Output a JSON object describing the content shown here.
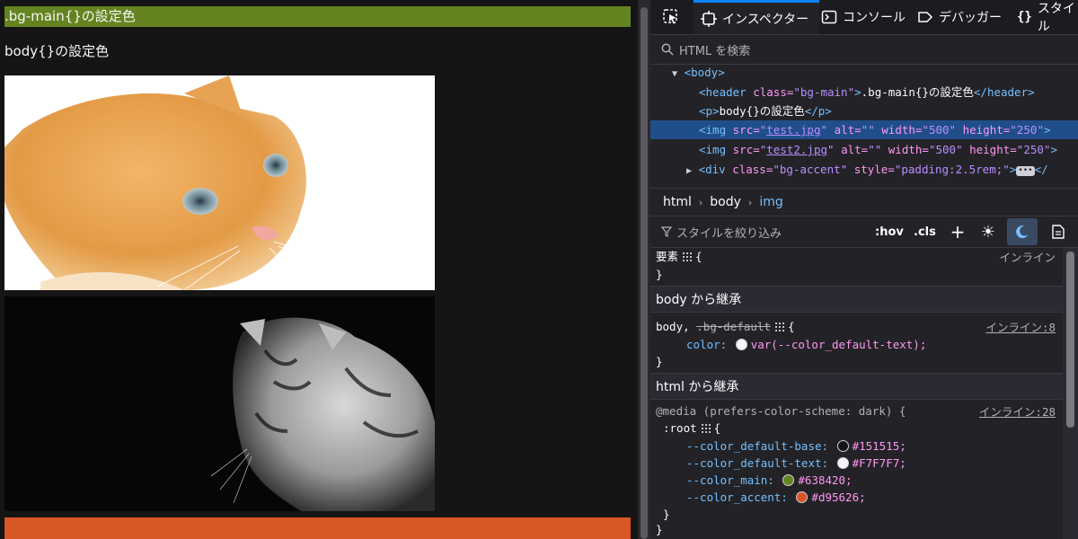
{
  "page": {
    "header_text": ".bg-main{}の設定色",
    "paragraph_text": "body{}の設定色"
  },
  "colors": {
    "base": "#151515",
    "text": "#F7F7F7",
    "main": "#638420",
    "accent": "#d95626",
    "devtools_selection": "#204e8a"
  },
  "devtools": {
    "tabs": {
      "inspector": "インスペクター",
      "console": "コンソール",
      "debugger": "デバッガー",
      "style": "スタイル"
    },
    "search_placeholder": "HTML を検索",
    "tree": {
      "body_open": "<body>",
      "header": {
        "open": "<header",
        "attr": "class=",
        "val": "\"bg-main\"",
        "close": ">",
        "text": ".bg-main{}の設定色",
        "end": "</header>"
      },
      "p": {
        "open": "<p>",
        "text": "body{}の設定色",
        "end": "</p>"
      },
      "img1": {
        "open": "<img",
        "src_attr": "src=",
        "src": "test.jpg",
        "alt_attr": "alt=",
        "alt": "\"\"",
        "w_attr": "width=",
        "w": "\"500\"",
        "h_attr": "height=",
        "h": "\"250\"",
        "close": ">"
      },
      "img2": {
        "open": "<img",
        "src_attr": "src=",
        "src": "test2.jpg",
        "alt_attr": "alt=",
        "alt": "\"\"",
        "w_attr": "width=",
        "w": "\"500\"",
        "h_attr": "height=",
        "h": "\"250\"",
        "close": ">"
      },
      "div": {
        "open": "<div",
        "class_attr": "class=",
        "class_val": "\"bg-accent\"",
        "style_attr": "style=",
        "style_val": "\"padding:2.5rem;\"",
        "close": ">",
        "end": "</"
      }
    },
    "breadcrumbs": [
      "html",
      "body",
      "img"
    ],
    "styles": {
      "filter_placeholder": "スタイルを絞り込み",
      "hov": ":hov",
      "cls": ".cls",
      "element_selector": "要素",
      "inline": "インライン",
      "brace_open": "{",
      "brace_close": "}",
      "inherit_body": "body から継承",
      "body_selector": "body,",
      "body_selector_struck": ".bg-default",
      "body_source": "インライン:8",
      "color_prop": "color:",
      "color_val": "var(--color_default-text);",
      "inherit_html": "html から継承",
      "media": "@media (prefers-color-scheme: dark) {",
      "media_source": "インライン:28",
      "root_selector": ":root",
      "vars": [
        {
          "name": "--color_default-base:",
          "value": "#151515;",
          "swatch": "#151515"
        },
        {
          "name": "--color_default-text:",
          "value": "#F7F7F7;",
          "swatch": "#F7F7F7"
        },
        {
          "name": "--color_main:",
          "value": "#638420;",
          "swatch": "#638420"
        },
        {
          "name": "--color_accent:",
          "value": "#d95626;",
          "swatch": "#d95626"
        }
      ]
    }
  }
}
